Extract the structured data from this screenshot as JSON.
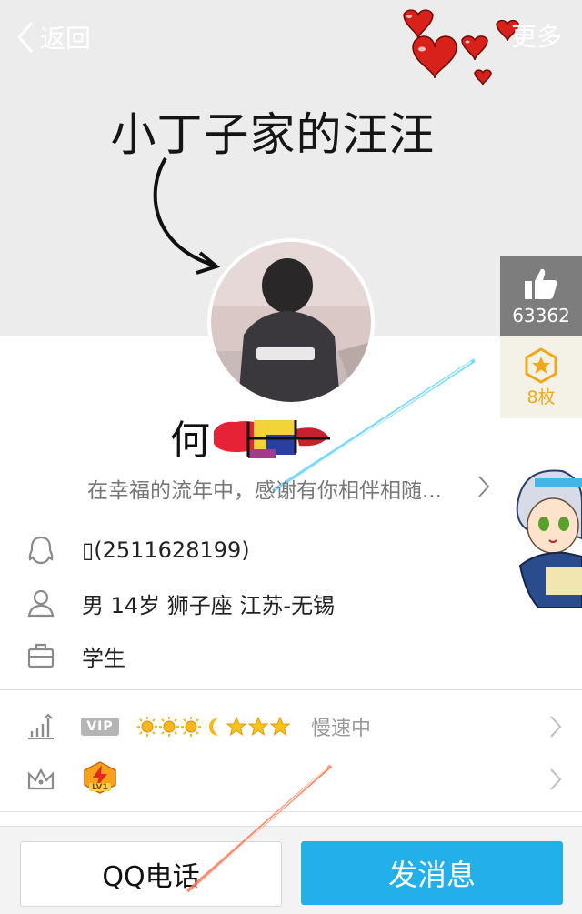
{
  "header": {
    "back_label": "返回",
    "more_label": "更多"
  },
  "cover": {
    "text": "小丁子家的汪汪"
  },
  "like_panel": {
    "like_count": "63362",
    "medal_count": "8枚"
  },
  "profile": {
    "nickname_visible": "何",
    "signature": "在幸福的流年中，感谢有你相伴相随...",
    "qq_number": "(2511628199)",
    "basic_info": "男  14岁  狮子座  江苏-无锡",
    "occupation": "学生"
  },
  "vip": {
    "badge": "VIP",
    "status": "慢速中"
  },
  "privilege": {
    "badge_level": "LV1"
  },
  "bottom_bar": {
    "call_label": "QQ电话",
    "message_label": "发消息"
  },
  "colors": {
    "accent_blue": "#23b0ea",
    "like_gray": "#7d7d7d",
    "medal_gold": "#f0a818"
  }
}
